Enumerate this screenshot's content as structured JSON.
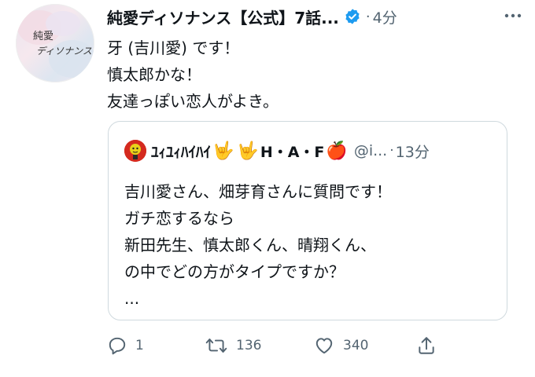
{
  "tweet": {
    "display_name": "純愛ディソナンス【公式】7話...",
    "time": "4分",
    "avatar_text_line1": "純愛",
    "avatar_text_line2": "ディソナンス",
    "lines": [
      "牙 (吉川愛) です！",
      "慎太郎かな！",
      "友達っぽい恋人がよき。"
    ]
  },
  "quote": {
    "name": "ﾕｨﾕｨﾊｲﾊｲ",
    "name_suffix": "H・A・F",
    "handle": "@i...",
    "time": "13分",
    "emoji_1": "🤟",
    "emoji_2": "🤟",
    "emoji_3": "🍎",
    "lines": [
      "吉川愛さん、畑芽育さんに質問です！",
      "ガチ恋するなら",
      "新田先生、慎太郎くん、晴翔くん、",
      "の中でどの方がタイプですか？",
      "..."
    ]
  },
  "actions": {
    "reply_count": "1",
    "retweet_count": "136",
    "like_count": "340"
  },
  "colors": {
    "secondary_text": "#536471",
    "verified_blue": "#1d9bf0",
    "border": "#cfd9de"
  },
  "icons": [
    "verified-badge-icon",
    "more-icon",
    "reply-icon",
    "retweet-icon",
    "like-icon",
    "share-icon"
  ]
}
